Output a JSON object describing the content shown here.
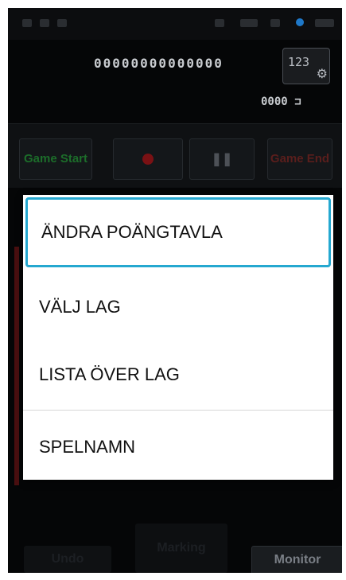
{
  "background_app": {
    "counter_text": "00000000000000",
    "settings_text": "123",
    "battery_text": "0000",
    "controls": {
      "game_start_label": "Game Start",
      "game_end_label": "Game End"
    },
    "bottom_buttons": {
      "undo_label": "Undo",
      "marking_label": "Marking",
      "monitor_label": "Monitor"
    }
  },
  "menu": {
    "items": [
      {
        "label": "ÄNDRA POÄNGTAVLA",
        "selected": true
      },
      {
        "label": "VÄLJ LAG",
        "selected": false
      },
      {
        "label": "LISTA ÖVER LAG",
        "selected": false
      },
      {
        "label": "SPELNAMN",
        "selected": false
      }
    ]
  },
  "colors": {
    "selection_border": "#25a8d0",
    "game_start_text": "#1c6d2a",
    "record_button": "#7a1114"
  },
  "icons": [
    "settings-gear-icon",
    "battery-icon",
    "record-icon",
    "pause-icon"
  ]
}
